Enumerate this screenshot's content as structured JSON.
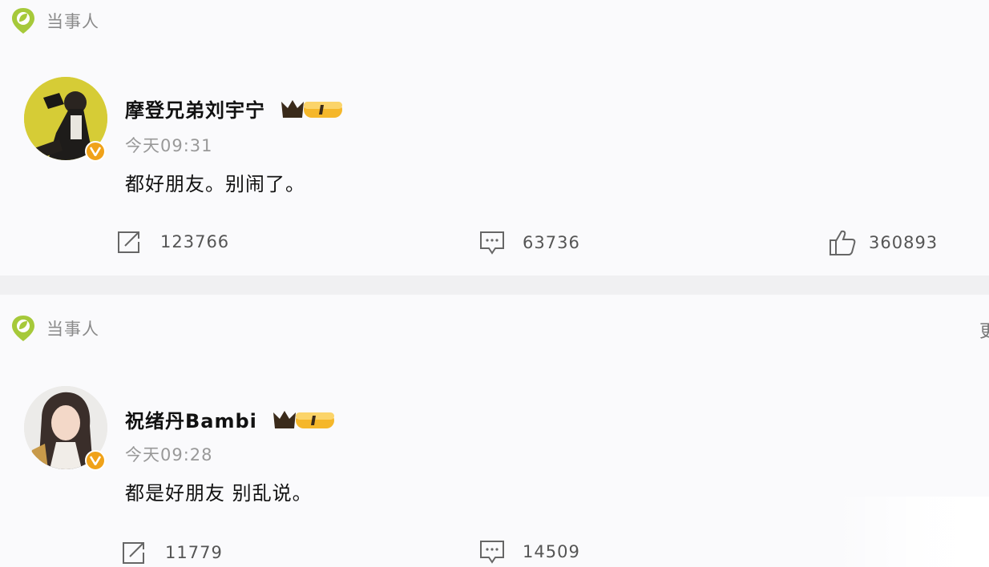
{
  "colors": {
    "accent_gold": "#f0a219",
    "tag_green": "#a6c93a",
    "text_dark": "#111111",
    "text_muted": "#999999"
  },
  "posts": [
    {
      "tag_icon": "location-pin-icon",
      "tag_label": "当事人",
      "author": "摩登兄弟刘宇宁",
      "member_badge": "crown-badge-icon",
      "verified_icon": "verified-v-icon",
      "time": "今天09:31",
      "text": "都好朋友。别闹了。",
      "actions": {
        "repost": {
          "icon": "share-icon",
          "count": "123766"
        },
        "comment": {
          "icon": "comment-icon",
          "count": "63736"
        },
        "like": {
          "icon": "thumbs-up-icon",
          "count": "360893"
        }
      }
    },
    {
      "tag_icon": "location-pin-icon",
      "tag_label": "当事人",
      "author": "祝绪丹Bambi",
      "member_badge": "crown-badge-icon",
      "verified_icon": "verified-v-icon",
      "time": "今天09:28",
      "text": "都是好朋友 别乱说。",
      "actions": {
        "repost": {
          "icon": "share-icon",
          "count": "11779"
        },
        "comment": {
          "icon": "comment-icon",
          "count": "14509"
        }
      }
    }
  ],
  "edge_fragment": "更"
}
